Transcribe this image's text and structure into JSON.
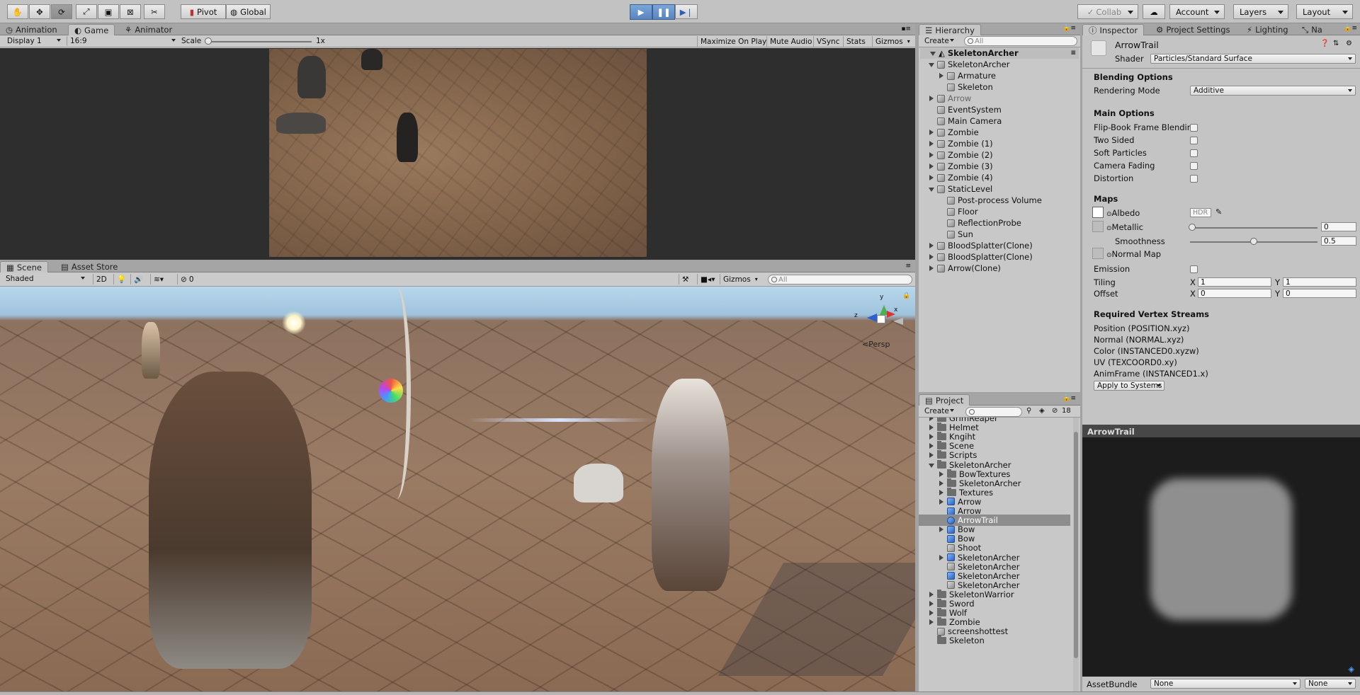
{
  "toolbar": {
    "tools": [
      "hand-tool",
      "move-tool",
      "rotate-tool",
      "scale-tool",
      "rect-tool",
      "transform-tool",
      "custom-tool"
    ],
    "pivot_label": "Pivot",
    "global_label": "Global",
    "collab_label": "Collab",
    "account_label": "Account",
    "layers_label": "Layers",
    "layout_label": "Layout"
  },
  "top_tabs": [
    "Animation",
    "Game",
    "Animator"
  ],
  "game_bar": {
    "display": "Display 1",
    "aspect": "16:9",
    "scale_label": "Scale",
    "scale_value": "1x",
    "buttons": [
      "Maximize On Play",
      "Mute Audio",
      "VSync",
      "Stats",
      "Gizmos"
    ]
  },
  "scene_tabs": [
    "Scene",
    "Asset Store"
  ],
  "scene_bar": {
    "shading": "Shaded",
    "mode_2d": "2D",
    "hidden_count": "0",
    "gizmos": "Gizmos",
    "search_placeholder": "All",
    "persp_label": "Persp"
  },
  "hierarchy": {
    "title": "Hierarchy",
    "create": "Create",
    "search_placeholder": "All",
    "scene_name": "SkeletonArcher",
    "items": [
      {
        "label": "SkeletonArcher",
        "depth": 1,
        "arrow": "d"
      },
      {
        "label": "Armature",
        "depth": 2,
        "arrow": "r"
      },
      {
        "label": "Skeleton",
        "depth": 2,
        "arrow": ""
      },
      {
        "label": "Arrow",
        "depth": 1,
        "arrow": "r",
        "dim": true
      },
      {
        "label": "EventSystem",
        "depth": 1,
        "arrow": ""
      },
      {
        "label": "Main Camera",
        "depth": 1,
        "arrow": ""
      },
      {
        "label": "Zombie",
        "depth": 1,
        "arrow": "r"
      },
      {
        "label": "Zombie (1)",
        "depth": 1,
        "arrow": "r"
      },
      {
        "label": "Zombie (2)",
        "depth": 1,
        "arrow": "r"
      },
      {
        "label": "Zombie (3)",
        "depth": 1,
        "arrow": "r"
      },
      {
        "label": "Zombie (4)",
        "depth": 1,
        "arrow": "r"
      },
      {
        "label": "StaticLevel",
        "depth": 1,
        "arrow": "d"
      },
      {
        "label": "Post-process Volume",
        "depth": 2,
        "arrow": ""
      },
      {
        "label": "Floor",
        "depth": 2,
        "arrow": ""
      },
      {
        "label": "ReflectionProbe",
        "depth": 2,
        "arrow": ""
      },
      {
        "label": "Sun",
        "depth": 2,
        "arrow": ""
      },
      {
        "label": "BloodSplatter(Clone)",
        "depth": 1,
        "arrow": "r"
      },
      {
        "label": "BloodSplatter(Clone)",
        "depth": 1,
        "arrow": "r"
      },
      {
        "label": "Arrow(Clone)",
        "depth": 1,
        "arrow": "r"
      }
    ]
  },
  "project": {
    "title": "Project",
    "create": "Create",
    "count": "18",
    "items": [
      {
        "label": "GrimReaper",
        "depth": 0,
        "arrow": "r",
        "icon": "folder"
      },
      {
        "label": "Helmet",
        "depth": 0,
        "arrow": "r",
        "icon": "folder"
      },
      {
        "label": "Kngiht",
        "depth": 0,
        "arrow": "r",
        "icon": "folder"
      },
      {
        "label": "Scene",
        "depth": 0,
        "arrow": "r",
        "icon": "folder"
      },
      {
        "label": "Scripts",
        "depth": 0,
        "arrow": "r",
        "icon": "folder"
      },
      {
        "label": "SkeletonArcher",
        "depth": 0,
        "arrow": "d",
        "icon": "folder"
      },
      {
        "label": "BowTextures",
        "depth": 1,
        "arrow": "r",
        "icon": "folder"
      },
      {
        "label": "SkeletonArcher",
        "depth": 1,
        "arrow": "r",
        "icon": "folder"
      },
      {
        "label": "Textures",
        "depth": 1,
        "arrow": "r",
        "icon": "folder"
      },
      {
        "label": "Arrow",
        "depth": 1,
        "arrow": "r",
        "icon": "prefab"
      },
      {
        "label": "Arrow",
        "depth": 1,
        "arrow": "",
        "icon": "prefab"
      },
      {
        "label": "ArrowTrail",
        "depth": 1,
        "arrow": "",
        "icon": "material",
        "selected": true
      },
      {
        "label": "Bow",
        "depth": 1,
        "arrow": "r",
        "icon": "prefab"
      },
      {
        "label": "Bow",
        "depth": 1,
        "arrow": "",
        "icon": "prefab"
      },
      {
        "label": "Shoot",
        "depth": 1,
        "arrow": "",
        "icon": "anim"
      },
      {
        "label": "SkeletonArcher",
        "depth": 1,
        "arrow": "r",
        "icon": "prefab"
      },
      {
        "label": "SkeletonArcher",
        "depth": 1,
        "arrow": "",
        "icon": "grid"
      },
      {
        "label": "SkeletonArcher",
        "depth": 1,
        "arrow": "",
        "icon": "prefab"
      },
      {
        "label": "SkeletonArcher",
        "depth": 1,
        "arrow": "",
        "icon": "unity"
      },
      {
        "label": "SkeletonWarrior",
        "depth": 0,
        "arrow": "r",
        "icon": "folder"
      },
      {
        "label": "Sword",
        "depth": 0,
        "arrow": "r",
        "icon": "folder"
      },
      {
        "label": "Wolf",
        "depth": 0,
        "arrow": "r",
        "icon": "folder"
      },
      {
        "label": "Zombie",
        "depth": 0,
        "arrow": "r",
        "icon": "folder"
      },
      {
        "label": "screenshottest",
        "depth": 0,
        "arrow": "",
        "icon": "script"
      },
      {
        "label": "Skeleton",
        "depth": 0,
        "arrow": "",
        "icon": "folder"
      }
    ]
  },
  "inspector": {
    "tabs": [
      "Inspector",
      "Project Settings",
      "Lighting",
      "Na"
    ],
    "material_name": "ArrowTrail",
    "shader_label": "Shader",
    "shader_value": "Particles/Standard Surface",
    "blending_header": "Blending Options",
    "rendering_mode_label": "Rendering Mode",
    "rendering_mode_value": "Additive",
    "main_header": "Main Options",
    "main_options": [
      "Flip-Book Frame Blending",
      "Two Sided",
      "Soft Particles",
      "Camera Fading",
      "Distortion"
    ],
    "maps_header": "Maps",
    "albedo_label": "Albedo",
    "hdr_label": "HDR",
    "metallic_label": "Metallic",
    "metallic_value": "0",
    "smoothness_label": "Smoothness",
    "smoothness_value": "0.5",
    "normal_map_label": "Normal Map",
    "emission_label": "Emission",
    "tiling_label": "Tiling",
    "tiling_x": "1",
    "tiling_y": "1",
    "offset_label": "Offset",
    "offset_x": "0",
    "offset_y": "0",
    "x_label": "X",
    "y_label": "Y",
    "vertex_header": "Required Vertex Streams",
    "vertex_streams": [
      "Position (POSITION.xyz)",
      "Normal (NORMAL.xyz)",
      "Color (INSTANCED0.xyzw)",
      "UV (TEXCOORD0.xy)",
      "AnimFrame (INSTANCED1.x)"
    ],
    "apply_button": "Apply to Systems",
    "preview_title": "ArrowTrail",
    "assetbundle_label": "AssetBundle",
    "assetbundle_value": "None",
    "assetbundle_variant": "None"
  },
  "colors": {
    "play_blue": "#5a84bf",
    "selection": "#8d8d8d"
  }
}
